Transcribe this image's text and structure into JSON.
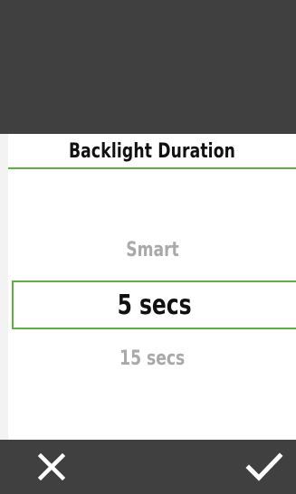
{
  "screen": {
    "title": "Backlight Duration",
    "options": [
      {
        "label": "Smart",
        "selected": false
      },
      {
        "label": "5 secs",
        "selected": true
      },
      {
        "label": "15 secs",
        "selected": false
      }
    ]
  },
  "toolbar": {
    "cancel_icon": "close-icon",
    "confirm_icon": "checkmark-icon"
  },
  "colors": {
    "accent": "#5fb13b",
    "dark": "#404040",
    "dim_text": "#a9a9a9",
    "text": "#111111"
  }
}
